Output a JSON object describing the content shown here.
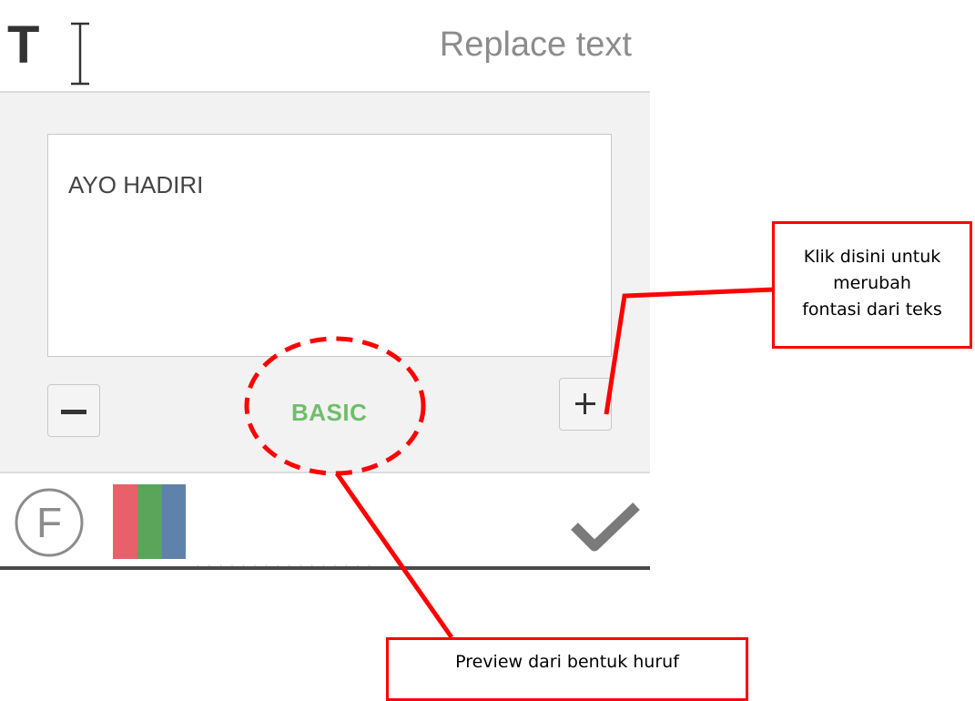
{
  "header": {
    "icon": "text-cursor-icon",
    "icon_letter": "T",
    "title": "Replace text"
  },
  "editor": {
    "text_value": "AYO HADIRI",
    "decrease_button": "minus-icon",
    "increase_button": "plus-icon",
    "font_preview": "BASIC",
    "font_preview_color": "#6fbe6a"
  },
  "toolbar": {
    "font_icon": "F",
    "color_icon": "color-swatch-icon",
    "color_swatches": [
      "#e8606a",
      "#5aa55a",
      "#5f82a8"
    ],
    "confirm_icon": "checkmark-icon"
  },
  "annotations": {
    "font_change_callout": [
      "Klik disini untuk",
      "merubah",
      "fontasi dari teks"
    ],
    "preview_callout": "Preview dari bentuk huruf",
    "accent_color": "#ff0000"
  }
}
